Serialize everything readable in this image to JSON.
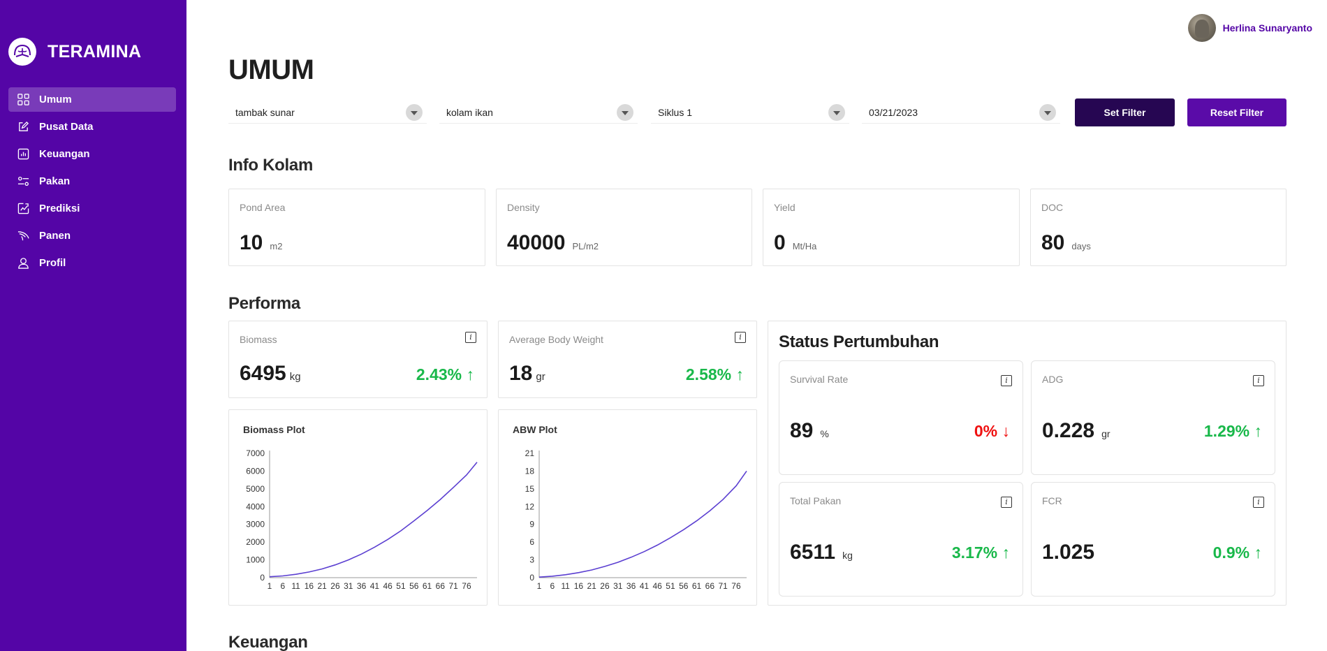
{
  "brand": {
    "name": "TERAMINA"
  },
  "sidebar": {
    "items": [
      {
        "label": "Umum",
        "icon": "grid-icon",
        "active": true
      },
      {
        "label": "Pusat Data",
        "icon": "edit-icon"
      },
      {
        "label": "Keuangan",
        "icon": "chart-icon"
      },
      {
        "label": "Pakan",
        "icon": "sliders-icon"
      },
      {
        "label": "Prediksi",
        "icon": "trend-icon"
      },
      {
        "label": "Panen",
        "icon": "fish-icon"
      },
      {
        "label": "Profil",
        "icon": "user-icon"
      }
    ]
  },
  "user": {
    "name": "Herlina Sunaryanto"
  },
  "page": {
    "title": "UMUM"
  },
  "filters": {
    "tambak": "tambak sunar",
    "kolam": "kolam ikan",
    "siklus": "Siklus 1",
    "date": "03/21/2023",
    "set_label": "Set Filter",
    "reset_label": "Reset Filter"
  },
  "info_kolam": {
    "title": "Info Kolam",
    "cards": [
      {
        "label": "Pond Area",
        "value": "10",
        "unit": "m2"
      },
      {
        "label": "Density",
        "value": "40000",
        "unit": "PL/m2"
      },
      {
        "label": "Yield",
        "value": "0",
        "unit": "Mt/Ha"
      },
      {
        "label": "DOC",
        "value": "80",
        "unit": "days"
      }
    ]
  },
  "performa": {
    "title": "Performa",
    "biomass": {
      "label": "Biomass",
      "value": "6495",
      "unit": "kg",
      "delta": "2.43%",
      "arrow": "↑"
    },
    "abw": {
      "label": "Average Body Weight",
      "value": "18",
      "unit": "gr",
      "delta": "2.58%",
      "arrow": "↑"
    }
  },
  "status": {
    "title": "Status Pertumbuhan",
    "cards": [
      {
        "label": "Survival Rate",
        "value": "89",
        "unit": "%",
        "delta": "0%",
        "arrow": "↓",
        "direction": "down"
      },
      {
        "label": "ADG",
        "value": "0.228",
        "unit": "gr",
        "delta": "1.29%",
        "arrow": "↑",
        "direction": "up"
      },
      {
        "label": "Total Pakan",
        "value": "6511",
        "unit": "kg",
        "delta": "3.17%",
        "arrow": "↑",
        "direction": "up"
      },
      {
        "label": "FCR",
        "value": "1.025",
        "unit": "",
        "delta": "0.9%",
        "arrow": "↑",
        "direction": "up"
      }
    ]
  },
  "keuangan": {
    "title": "Keuangan"
  },
  "colors": {
    "primary": "#5405a6",
    "dark": "#260652",
    "up": "#19b84a",
    "down": "#ef1111",
    "line": "#5b3fd1"
  },
  "chart_data": [
    {
      "type": "line",
      "title": "Biomass Plot",
      "x_ticks": [
        "1",
        "6",
        "11",
        "16",
        "21",
        "26",
        "31",
        "36",
        "41",
        "46",
        "51",
        "56",
        "61",
        "66",
        "71",
        "76"
      ],
      "y_ticks": [
        "0",
        "1000",
        "2000",
        "3000",
        "4000",
        "5000",
        "6000",
        "7000"
      ],
      "ylim": [
        0,
        7000
      ],
      "xlim": [
        1,
        80
      ],
      "series": [
        {
          "x": [
            1,
            6,
            11,
            16,
            21,
            26,
            31,
            36,
            41,
            46,
            51,
            56,
            61,
            66,
            71,
            76,
            80
          ],
          "y": [
            50,
            100,
            190,
            320,
            490,
            720,
            1000,
            1330,
            1720,
            2150,
            2640,
            3200,
            3780,
            4400,
            5080,
            5780,
            6495
          ]
        }
      ]
    },
    {
      "type": "line",
      "title": "ABW Plot",
      "x_ticks": [
        "1",
        "6",
        "11",
        "16",
        "21",
        "26",
        "31",
        "36",
        "41",
        "46",
        "51",
        "56",
        "61",
        "66",
        "71",
        "76"
      ],
      "y_ticks": [
        "0",
        "3",
        "6",
        "9",
        "12",
        "15",
        "18",
        "21"
      ],
      "ylim": [
        0,
        21
      ],
      "xlim": [
        1,
        80
      ],
      "series": [
        {
          "x": [
            1,
            6,
            11,
            16,
            21,
            26,
            31,
            36,
            41,
            46,
            51,
            56,
            61,
            66,
            71,
            76,
            80
          ],
          "y": [
            0.1,
            0.25,
            0.5,
            0.85,
            1.3,
            1.9,
            2.6,
            3.45,
            4.4,
            5.5,
            6.75,
            8.1,
            9.6,
            11.3,
            13.2,
            15.5,
            18
          ]
        }
      ]
    }
  ]
}
